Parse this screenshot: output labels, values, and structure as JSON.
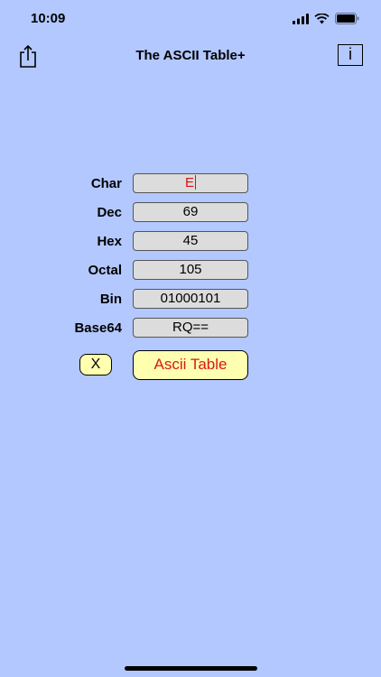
{
  "status_bar": {
    "time": "10:09"
  },
  "nav": {
    "title": "The ASCII Table+",
    "info_label": "i"
  },
  "fields": {
    "char": {
      "label": "Char",
      "value": "E"
    },
    "dec": {
      "label": "Dec",
      "value": "69"
    },
    "hex": {
      "label": "Hex",
      "value": "45"
    },
    "octal": {
      "label": "Octal",
      "value": "105"
    },
    "bin": {
      "label": "Bin",
      "value": "01000101"
    },
    "base64": {
      "label": "Base64",
      "value": "RQ=="
    }
  },
  "buttons": {
    "clear_label": "X",
    "ascii_table_label": "Ascii Table"
  },
  "colors": {
    "background": "#b3c8ff",
    "button_fill": "#ffffb0",
    "accent_red": "#d81818"
  }
}
